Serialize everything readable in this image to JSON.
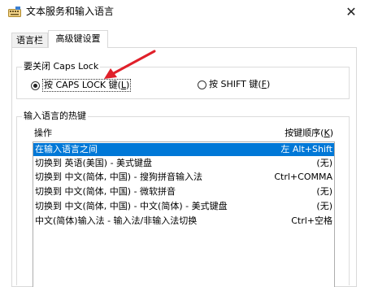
{
  "window": {
    "title": "文本服务和输入语言",
    "close_symbol": "✕"
  },
  "tabs": [
    {
      "label": "语言栏",
      "active": false
    },
    {
      "label": "高级键设置",
      "active": true
    }
  ],
  "caps_lock_group": {
    "legend": "要关闭 Caps Lock",
    "option1": {
      "label_prefix": "按 CAPS LOCK 键(",
      "mnemonic": "L",
      "label_suffix": ")",
      "selected": true
    },
    "option2": {
      "label_prefix": "按 SHIFT 键(",
      "mnemonic": "F",
      "label_suffix": ")",
      "selected": false
    }
  },
  "hotkey_group": {
    "legend": "输入语言的热键",
    "col_operation": "操作",
    "col_sequence_prefix": "按键顺序(",
    "col_sequence_mnemonic": "K",
    "col_sequence_suffix": ")",
    "rows": [
      {
        "action": "在输入语言之间",
        "keys": "左 Alt+Shift",
        "selected": true
      },
      {
        "action": "切换到 英语(美国) - 美式键盘",
        "keys": "(无)",
        "selected": false
      },
      {
        "action": "切换到 中文(简体, 中国) - 搜狗拼音输入法",
        "keys": "Ctrl+COMMA",
        "selected": false
      },
      {
        "action": "切换到 中文(简体, 中国) - 微软拼音",
        "keys": "(无)",
        "selected": false
      },
      {
        "action": "切换到 中文(简体, 中国) - 中文(简体) - 美式键盘",
        "keys": "(无)",
        "selected": false
      },
      {
        "action": "中文(简体)输入法 - 输入法/非输入法切换",
        "keys": "Ctrl+空格",
        "selected": false
      }
    ]
  },
  "colors": {
    "selection": "#0078d7",
    "annotation_arrow": "#e0202a"
  },
  "icons": {
    "app": "keyboard-settings-icon",
    "close": "close-icon",
    "annotation": "red-arrow-icon"
  }
}
